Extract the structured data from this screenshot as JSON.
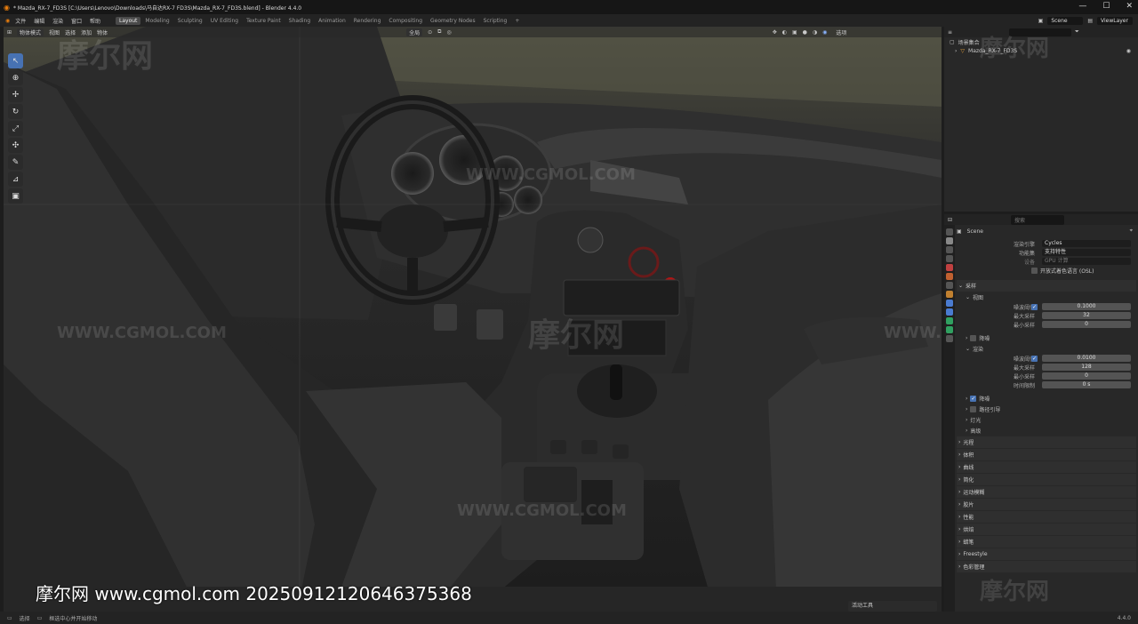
{
  "title": "* Mazda_RX-7_FD3S [C:\\Users\\Lenovo\\Downloads\\马自达RX-7 FD3S\\Mazda_RX-7_FD3S.blend] - Blender 4.4.0",
  "window_controls": {
    "minimize": "—",
    "maximize": "☐",
    "close": "✕"
  },
  "menu": [
    "文件",
    "编辑",
    "渲染",
    "窗口",
    "帮助"
  ],
  "tabs": [
    "Layout",
    "Modeling",
    "Sculpting",
    "UV Editing",
    "Texture Paint",
    "Shading",
    "Animation",
    "Rendering",
    "Compositing",
    "Geometry Nodes",
    "Scripting"
  ],
  "active_tab": "Layout",
  "add_tab": "+",
  "scene_field": "Scene",
  "viewlayer_field": "ViewLayer",
  "viewport": {
    "mode": "物体模式",
    "header_menu": [
      "视图",
      "选择",
      "添加",
      "物体"
    ],
    "transform": "全局",
    "options_label": "选项",
    "watermarks": [
      "摩尔网",
      "WWW.CGMOL.COM"
    ]
  },
  "outliner": {
    "search_placeholder": "",
    "rows": [
      {
        "label": "场景集合"
      },
      {
        "label": "Mazda_RX-7_FD3S"
      }
    ]
  },
  "properties": {
    "search_placeholder": "搜索",
    "scene_label": "Scene",
    "render_engine_label": "渲染引擎",
    "render_engine": "Cycles",
    "feature_set_label": "功能集",
    "feature_set": "支持特性",
    "device_label": "设备",
    "device": "GPU 计算",
    "osl_label": "开放式着色语言 (OSL)",
    "sampling": "采样",
    "viewport_section": "视图",
    "noise_threshold_label": "噪波阈值",
    "viewport_noise": "0.1000",
    "max_samples_label": "最大采样",
    "viewport_max": "32",
    "min_samples_label": "最小采样",
    "viewport_min": "0",
    "denoise": "降噪",
    "render_section": "渲染",
    "render_noise": "0.0100",
    "render_max": "128",
    "render_min": "0",
    "time_limit_label": "时间限制",
    "time_limit": "0 s",
    "denoise2": "降噪",
    "path_guiding": "路径引导",
    "lights": "灯光",
    "advanced": "高级",
    "sections": [
      "光程",
      "体积",
      "曲线",
      "简化",
      "运动模糊",
      "胶片",
      "性能",
      "烘焙",
      "蜡笔",
      "Freestyle",
      "色彩管理"
    ]
  },
  "operator_panel": "活动工具",
  "status": {
    "select": "选择",
    "center": "框选中心并开始移动",
    "version": "4.4.0"
  },
  "footer_url": "摩尔网 www.cgmol.com 20250912120646375368"
}
